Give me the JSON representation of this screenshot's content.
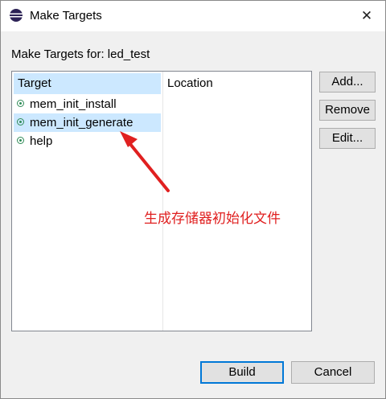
{
  "window": {
    "title": "Make Targets",
    "close_glyph": "✕",
    "icon": "eclipse-icon"
  },
  "header": {
    "label": "Make Targets for: led_test"
  },
  "table": {
    "columns": [
      "Target",
      "Location"
    ],
    "rows": [
      {
        "name": "mem_init_install",
        "icon": "target-icon"
      },
      {
        "name": "mem_init_generate",
        "icon": "target-icon",
        "selected": true
      },
      {
        "name": "help",
        "icon": "target-icon"
      }
    ]
  },
  "side_buttons": {
    "add": "Add...",
    "remove": "Remove",
    "edit": "Edit..."
  },
  "footer_buttons": {
    "build": "Build",
    "cancel": "Cancel"
  },
  "annotation": {
    "text": "生成存储器初始化文件",
    "color": "#e02020"
  }
}
